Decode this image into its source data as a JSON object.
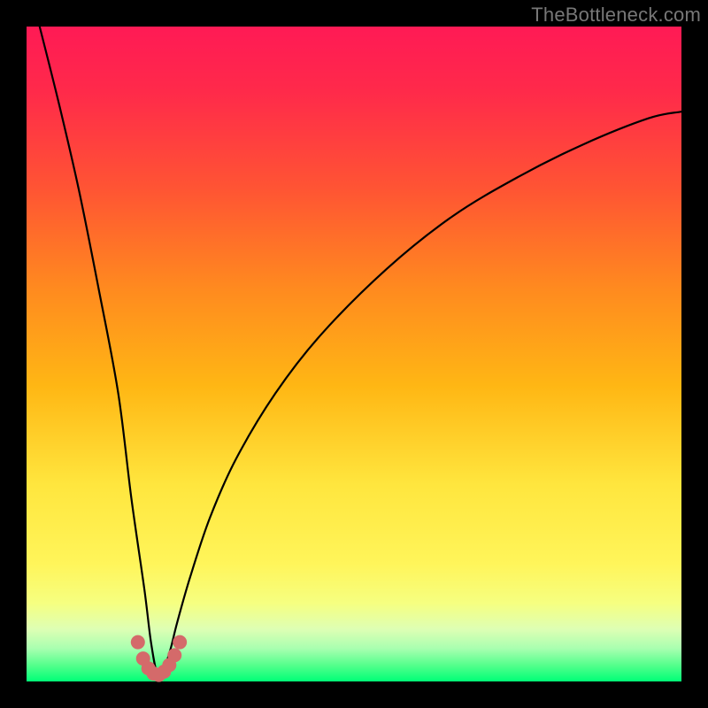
{
  "watermark": "TheBottleneck.com",
  "colors": {
    "frame_bg": "#000000",
    "curve": "#000000",
    "marker_fill": "#d46a6a",
    "marker_stroke": "#d46a6a",
    "gradient_stops": [
      {
        "offset": 0.0,
        "color": "#ff1a55"
      },
      {
        "offset": 0.1,
        "color": "#ff2a4a"
      },
      {
        "offset": 0.25,
        "color": "#ff5533"
      },
      {
        "offset": 0.4,
        "color": "#ff8a1f"
      },
      {
        "offset": 0.55,
        "color": "#ffb714"
      },
      {
        "offset": 0.7,
        "color": "#ffe63e"
      },
      {
        "offset": 0.82,
        "color": "#fff55a"
      },
      {
        "offset": 0.88,
        "color": "#f6ff80"
      },
      {
        "offset": 0.92,
        "color": "#deffb4"
      },
      {
        "offset": 0.95,
        "color": "#a8ffb0"
      },
      {
        "offset": 0.975,
        "color": "#55ff8c"
      },
      {
        "offset": 1.0,
        "color": "#00ff77"
      }
    ]
  },
  "chart_data": {
    "type": "line",
    "title": "",
    "xlabel": "",
    "ylabel": "",
    "xlim": [
      0,
      100
    ],
    "ylim": [
      0,
      100
    ],
    "note": "V-shaped bottleneck curve. x represents hardware balance axis (0-100), y represents bottleneck percentage (0 = balanced / green, 100 = severe / red). Minimum sits near x ≈ 20. Values are read off the gradient bands; precision ≈ ±3.",
    "series": [
      {
        "name": "bottleneck-curve",
        "x": [
          2,
          5,
          8,
          11,
          14,
          16,
          18,
          19,
          20,
          21,
          22,
          23,
          25,
          28,
          32,
          38,
          45,
          55,
          65,
          75,
          85,
          95,
          100
        ],
        "y": [
          100,
          88,
          75,
          60,
          44,
          28,
          14,
          6,
          1,
          2,
          5,
          9,
          16,
          25,
          34,
          44,
          53,
          63,
          71,
          77,
          82,
          86,
          87
        ]
      }
    ],
    "markers": {
      "name": "optimal-range-markers",
      "note": "Small rounded markers clustered around the trough (optimal balance zone).",
      "x": [
        17.0,
        17.8,
        18.6,
        19.4,
        20.2,
        21.0,
        21.8,
        22.6,
        23.4
      ],
      "y": [
        6.0,
        3.5,
        2.0,
        1.2,
        1.0,
        1.5,
        2.5,
        4.0,
        6.0
      ]
    }
  }
}
